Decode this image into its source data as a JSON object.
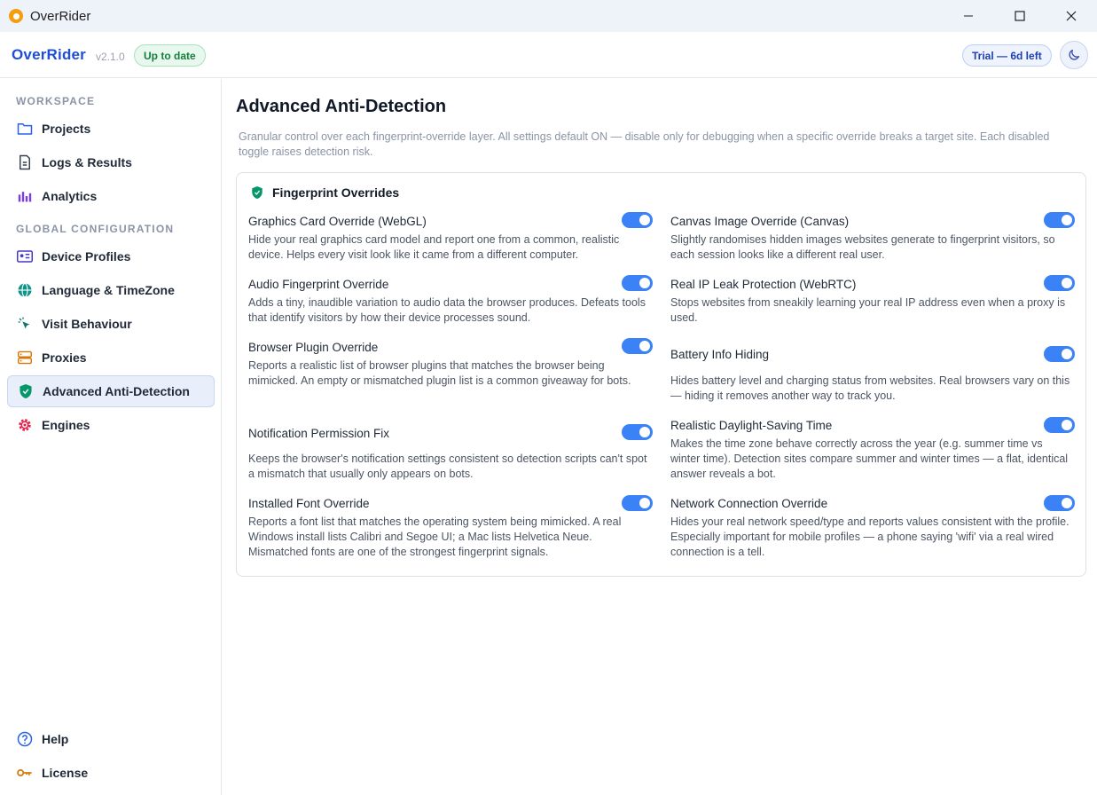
{
  "window": {
    "title": "OverRider"
  },
  "header": {
    "brand": "OverRider",
    "version": "v2.1.0",
    "status_badge": "Up to date",
    "trial_badge": "Trial — 6d left"
  },
  "sidebar": {
    "section_workspace": "WORKSPACE",
    "section_global": "GLOBAL CONFIGURATION",
    "items": {
      "projects": "Projects",
      "logs": "Logs & Results",
      "analytics": "Analytics",
      "device_profiles": "Device Profiles",
      "language": "Language & TimeZone",
      "visit": "Visit Behaviour",
      "proxies": "Proxies",
      "anti_detection": "Advanced Anti-Detection",
      "engines": "Engines",
      "help": "Help",
      "license": "License"
    }
  },
  "main": {
    "title": "Advanced Anti-Detection",
    "description": "Granular control over each fingerprint-override layer. All settings default ON — disable only for debugging when a specific override breaks a target site. Each disabled toggle raises detection risk.",
    "card_title": "Fingerprint Overrides",
    "settings": [
      {
        "title": "Graphics Card Override (WebGL)",
        "desc": "Hide your real graphics card model and report one from a common, realistic device. Helps every visit look like it came from a different computer.",
        "enabled": true
      },
      {
        "title": "Canvas Image Override (Canvas)",
        "desc": "Slightly randomises hidden images websites generate to fingerprint visitors, so each session looks like a different real user.",
        "enabled": true
      },
      {
        "title": "Audio Fingerprint Override",
        "desc": "Adds a tiny, inaudible variation to audio data the browser produces. Defeats tools that identify visitors by how their device processes sound.",
        "enabled": true
      },
      {
        "title": "Real IP Leak Protection (WebRTC)",
        "desc": "Stops websites from sneakily learning your real IP address even when a proxy is used.",
        "enabled": true
      },
      {
        "title": "Browser Plugin Override",
        "desc": "Reports a realistic list of browser plugins that matches the browser being mimicked. An empty or mismatched plugin list is a common giveaway for bots.",
        "enabled": true
      },
      {
        "title": "Battery Info Hiding",
        "desc": "Hides battery level and charging status from websites. Real browsers vary on this — hiding it removes another way to track you.",
        "enabled": true
      },
      {
        "title": "Notification Permission Fix",
        "desc": "Keeps the browser's notification settings consistent so detection scripts can't spot a mismatch that usually only appears on bots.",
        "enabled": true
      },
      {
        "title": "Realistic Daylight-Saving Time",
        "desc": "Makes the time zone behave correctly across the year (e.g. summer time vs winter time). Detection sites compare summer and winter times — a flat, identical answer reveals a bot.",
        "enabled": true
      },
      {
        "title": "Installed Font Override",
        "desc": "Reports a font list that matches the operating system being mimicked. A real Windows install lists Calibri and Segoe UI; a Mac lists Helvetica Neue. Mismatched fonts are one of the strongest fingerprint signals.",
        "enabled": true
      },
      {
        "title": "Network Connection Override",
        "desc": "Hides your real network speed/type and reports values consistent with the profile. Especially important for mobile profiles — a phone saying 'wifi' via a real wired connection is a tell.",
        "enabled": true
      }
    ]
  },
  "colors": {
    "accent": "#3b82f6",
    "brand": "#1d4ed8",
    "success": "#15803d"
  }
}
